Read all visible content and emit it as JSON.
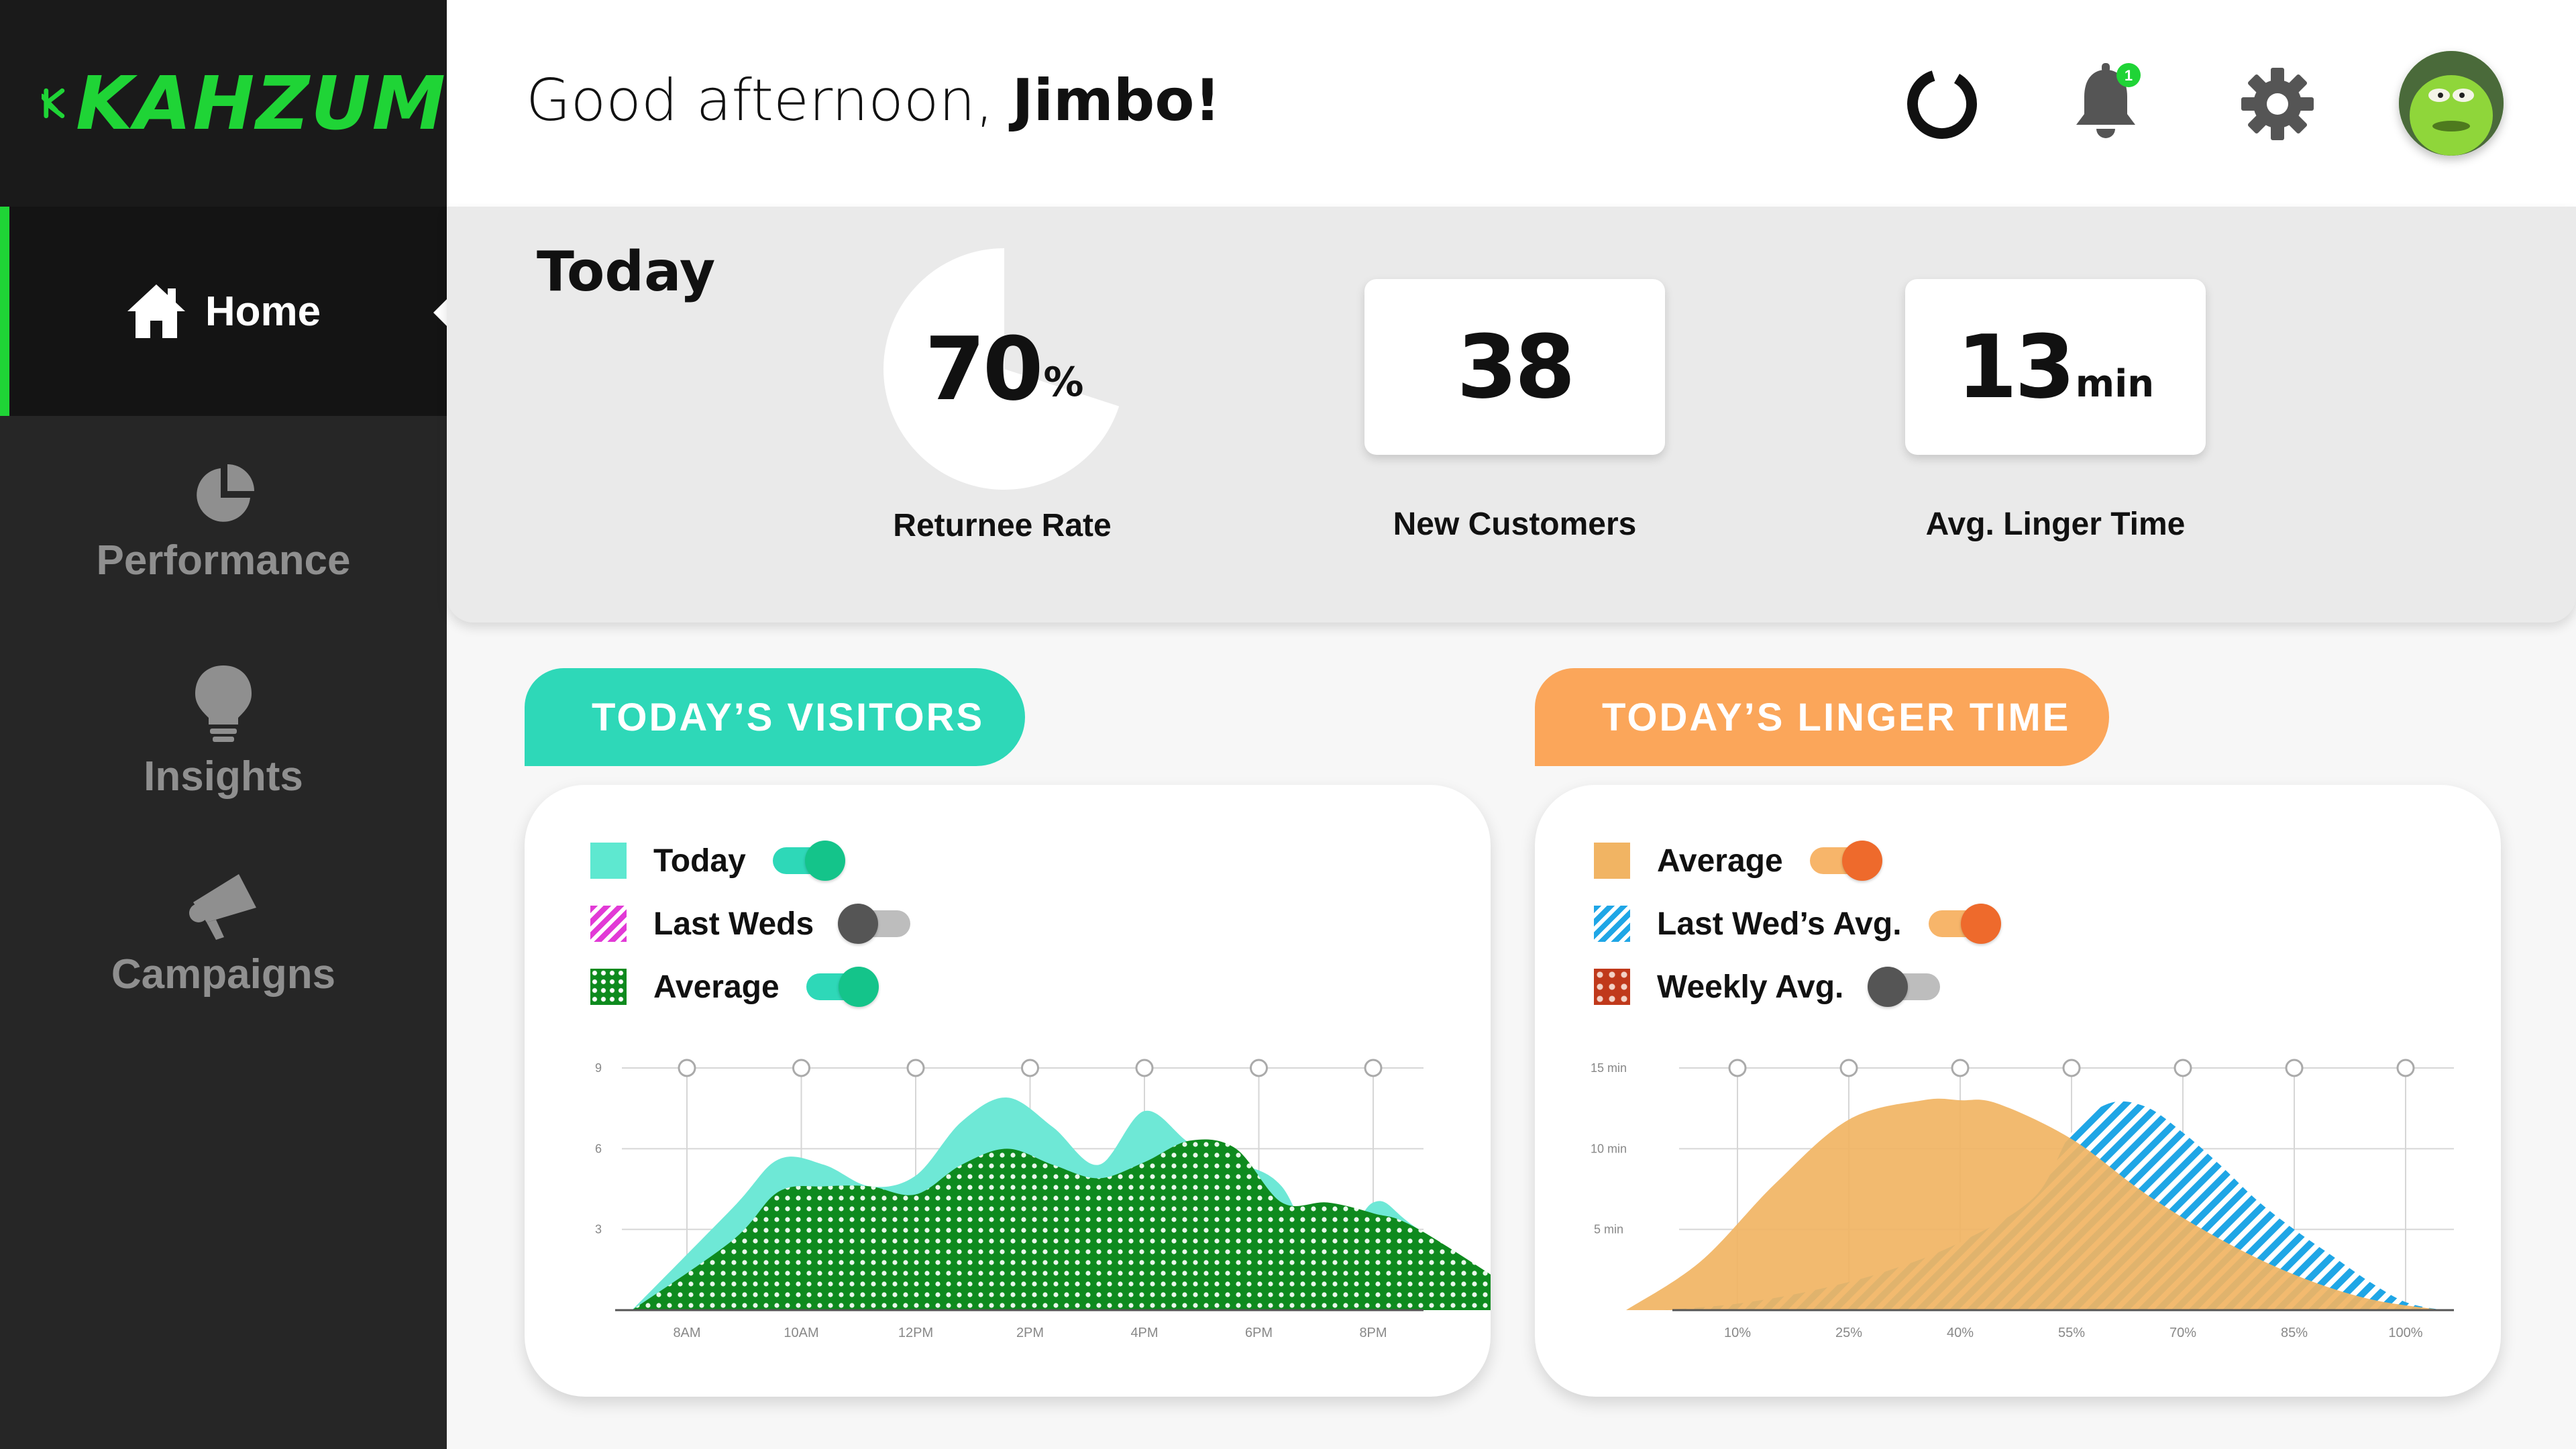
{
  "brand": {
    "name": "KAHZUM",
    "accent": "#1fd436"
  },
  "header": {
    "greeting_prefix": "Good afternoon, ",
    "user_name": "Jimbo!",
    "notification_count": "1"
  },
  "sidebar": {
    "items": [
      {
        "label": "Home",
        "icon": "home-icon",
        "active": true
      },
      {
        "label": "Performance",
        "icon": "pie-chart-icon",
        "active": false
      },
      {
        "label": "Insights",
        "icon": "lightbulb-icon",
        "active": false
      },
      {
        "label": "Campaigns",
        "icon": "megaphone-icon",
        "active": false
      }
    ]
  },
  "today": {
    "title": "Today",
    "returnee_rate": {
      "value": "70",
      "unit": "%",
      "label": "Returnee Rate",
      "fraction": 0.7
    },
    "new_customers": {
      "value": "38",
      "label": "New Customers"
    },
    "linger_time": {
      "value": "13",
      "unit": "min",
      "label": "Avg. Linger Time"
    }
  },
  "visitors_chart": {
    "tab_label": "TODAY’S VISITORS",
    "color": "#2ed8b8",
    "legend": [
      {
        "label": "Today",
        "swatch": "#5ee8d0",
        "toggle": "on",
        "toggle_color": "#14c48a",
        "track_color": "#2ed8b8"
      },
      {
        "label": "Last Weds",
        "swatch": "#e23ad6",
        "toggle": "off",
        "toggle_color": "#555555",
        "track_color": "#bdbdbd"
      },
      {
        "label": "Average",
        "swatch": "#0e8a1e",
        "toggle": "on",
        "toggle_color": "#14c48a",
        "track_color": "#2ed8b8"
      }
    ]
  },
  "linger_chart": {
    "tab_label": "TODAY’S LINGER TIME",
    "color": "#fba65a",
    "legend": [
      {
        "label": "Average",
        "swatch": "#f1b463",
        "toggle": "on",
        "toggle_color": "#ee6a2c",
        "track_color": "#f7b56a"
      },
      {
        "label": "Last Wed’s Avg.",
        "swatch": "#1fa6e6",
        "toggle": "on",
        "toggle_color": "#ee6a2c",
        "track_color": "#f7b56a"
      },
      {
        "label": "Weekly Avg.",
        "swatch": "#c0391b",
        "toggle": "off",
        "toggle_color": "#555555",
        "track_color": "#bdbdbd"
      }
    ]
  },
  "chart_data": [
    {
      "type": "area",
      "x_labels": [
        "8AM",
        "10AM",
        "12PM",
        "2PM",
        "4PM",
        "6PM",
        "8PM"
      ],
      "y_ticks": [
        "3",
        "6",
        "9"
      ],
      "ylim": [
        0,
        9
      ],
      "series": [
        {
          "name": "Today",
          "color": "#6ee8d6",
          "x": [
            0,
            0.4,
            0.8,
            1.2,
            1.6,
            2.0,
            2.4,
            2.8,
            3.2,
            3.6,
            4.0,
            4.4,
            4.8,
            5.2,
            5.6,
            6.0,
            6.4,
            6.8
          ],
          "y": [
            0,
            3.8,
            5.6,
            5.4,
            4.6,
            5.0,
            7.0,
            7.9,
            6.8,
            5.4,
            7.4,
            6.2,
            5.5,
            4.6,
            1.6,
            4.0,
            3.0,
            0
          ]
        },
        {
          "name": "Average",
          "color": "#0e8a1e",
          "x": [
            0,
            0.4,
            0.8,
            1.2,
            1.6,
            2.0,
            2.4,
            2.8,
            3.2,
            3.6,
            4.0,
            4.4,
            4.8,
            5.2,
            5.6,
            6.0,
            6.4,
            6.8
          ],
          "y": [
            0,
            2.6,
            4.4,
            4.6,
            4.6,
            4.3,
            5.4,
            6.0,
            5.4,
            4.9,
            5.5,
            6.3,
            6.0,
            4.0,
            4.0,
            3.6,
            3.0,
            0
          ]
        }
      ]
    },
    {
      "type": "area",
      "x_labels": [
        "10%",
        "25%",
        "40%",
        "55%",
        "70%",
        "85%",
        "100%"
      ],
      "y_ticks": [
        "5 min",
        "10 min",
        "15 min"
      ],
      "ylim": [
        0,
        15
      ],
      "series": [
        {
          "name": "Last Wed’s Avg.",
          "color": "#1fa6e6",
          "x": [
            0,
            10,
            20,
            30,
            40,
            50,
            55,
            60,
            65,
            70,
            75,
            80,
            85,
            90,
            95,
            100,
            105
          ],
          "y": [
            0,
            0.4,
            1.2,
            2.4,
            4.2,
            7.0,
            11.0,
            12.8,
            12.6,
            11.0,
            9.0,
            6.8,
            5.0,
            3.4,
            1.8,
            0.5,
            0
          ]
        },
        {
          "name": "Average",
          "color": "#f1b463",
          "x": [
            -5,
            5,
            15,
            25,
            35,
            40,
            45,
            55,
            65,
            75,
            85,
            95,
            105
          ],
          "y": [
            0,
            3.0,
            7.8,
            11.8,
            13.0,
            13.0,
            12.8,
            10.6,
            7.2,
            4.4,
            2.2,
            0.7,
            0
          ]
        }
      ]
    }
  ]
}
